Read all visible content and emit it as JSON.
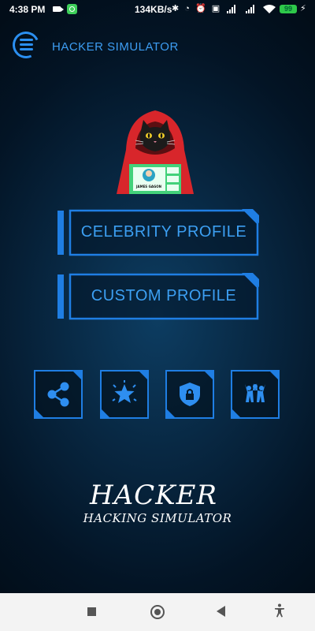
{
  "status_bar": {
    "time": "4:38 PM",
    "network_speed": "134KB/s",
    "icons_text": "✱ ◔ ⏰ ▣",
    "battery": "99",
    "colors": {
      "battery": "#2ec84a",
      "whatsapp": "#3ecf5a"
    }
  },
  "header": {
    "title": "HACKER SIMULATOR",
    "menu_icon": "menu-icon"
  },
  "mascot": {
    "badge_name": "JAMES GAGON",
    "icon": "hooded-cat-hacker-icon"
  },
  "profile_buttons": [
    {
      "label": "CELEBRITY PROFILE"
    },
    {
      "label": "CUSTOM PROFILE"
    }
  ],
  "tiles": [
    {
      "icon": "share-icon"
    },
    {
      "icon": "star-rate-icon"
    },
    {
      "icon": "privacy-shield-icon"
    },
    {
      "icon": "community-icon"
    }
  ],
  "brand": {
    "title": "HACKER",
    "subtitle": "HACKING SIMULATOR"
  },
  "colors": {
    "accent": "#3c9ff2",
    "background_center": "#0d3d62",
    "background_edge": "#020d18"
  }
}
